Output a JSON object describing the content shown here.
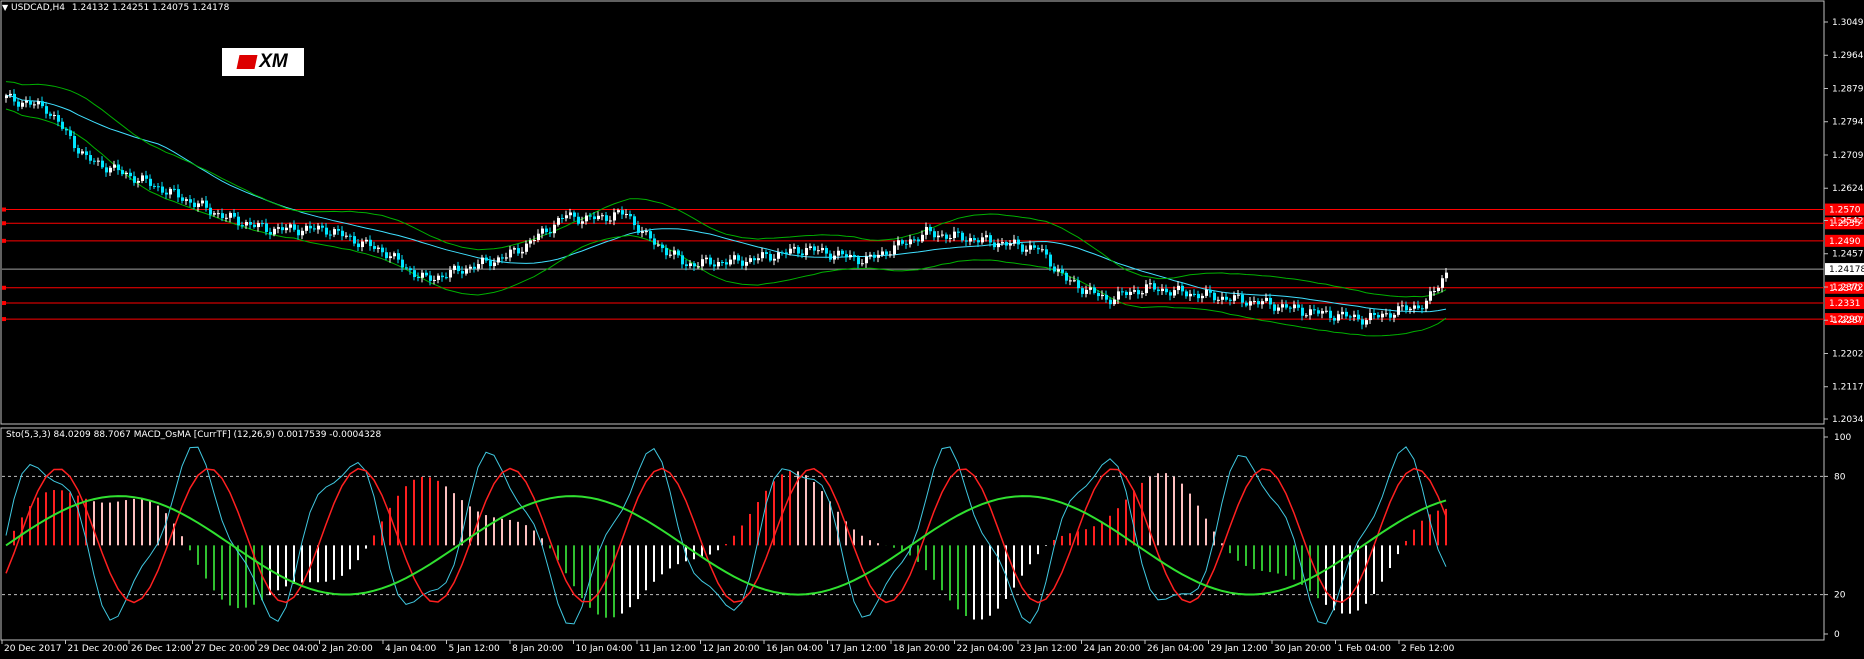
{
  "main_chart": {
    "symbol_menu_icon": "triangle-down-icon",
    "symbol": "USDCAD,H4",
    "ohlc": "1.24132 1.24251 1.24075 1.24178",
    "logo_text": "XM",
    "current_price": "1.24178"
  },
  "price_axis": {
    "ticks": [
      "1.30495",
      "1.29645",
      "1.28795",
      "1.27945",
      "1.27095",
      "1.26245",
      "1.25420",
      "1.24570",
      "1.23720",
      "1.22870",
      "1.22020",
      "1.21170",
      "1.20345"
    ]
  },
  "level_labels": [
    "1.2570",
    "1.2535",
    "1.2490",
    "1.2370",
    "1.2331",
    "1.2290"
  ],
  "indicator": {
    "title": "Sto(5,3,3) 84.0209 88.7067  MACD_OsMA [CurrTF] (12,26,9) 0.0017539 -0.0004328",
    "axis_ticks": [
      "100",
      "80",
      "20",
      "0"
    ]
  },
  "time_axis": {
    "labels": [
      "20 Dec 2017",
      "21 Dec 20:00",
      "26 Dec 12:00",
      "27 Dec 20:00",
      "29 Dec 04:00",
      "2 Jan 20:00",
      "4 Jan 04:00",
      "5 Jan 12:00",
      "8 Jan 20:00",
      "10 Jan 04:00",
      "11 Jan 12:00",
      "12 Jan 20:00",
      "16 Jan 04:00",
      "17 Jan 12:00",
      "18 Jan 20:00",
      "22 Jan 04:00",
      "23 Jan 12:00",
      "24 Jan 20:00",
      "26 Jan 04:00",
      "29 Jan 12:00",
      "30 Jan 20:00",
      "1 Feb 04:00",
      "2 Feb 12:00"
    ]
  },
  "colors": {
    "bull": "#ffffff",
    "bear": "#00e5ff",
    "level": "#ff0000",
    "ma": "#40e0ff",
    "bands": "#00b000",
    "grid": "#c0c0c0"
  }
}
